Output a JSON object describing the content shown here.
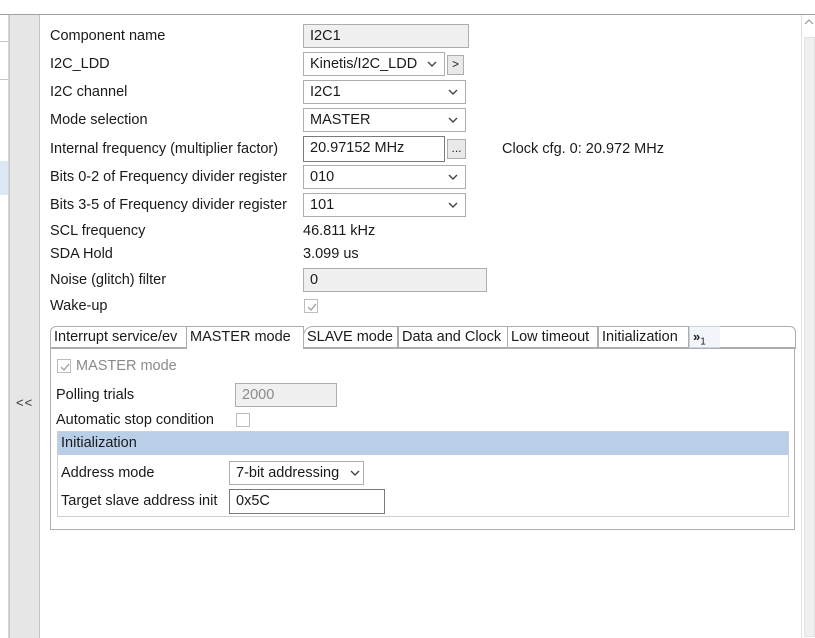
{
  "collapse": {
    "label": "<<"
  },
  "props": {
    "component_name": {
      "label": "Component name",
      "value": "I2C1"
    },
    "i2c_ldd": {
      "label": "I2C_LDD",
      "value": "Kinetis/I2C_LDD",
      "goto": ">"
    },
    "channel": {
      "label": "I2C channel",
      "value": "I2C1"
    },
    "mode": {
      "label": "Mode selection",
      "value": "MASTER"
    },
    "int_freq": {
      "label": "Internal frequency (multiplier factor)",
      "value": "20.97152 MHz",
      "browse": "...",
      "clock_note": "Clock cfg. 0: 20.972 MHz"
    },
    "bits02": {
      "label": "Bits 0-2 of Frequency divider register",
      "value": "010"
    },
    "bits35": {
      "label": "Bits 3-5 of Frequency divider register",
      "value": "101"
    },
    "scl": {
      "label": "SCL frequency",
      "value": "46.811 kHz"
    },
    "sda_hold": {
      "label": "SDA Hold",
      "value": "3.099 us"
    },
    "noise": {
      "label": "Noise (glitch) filter",
      "value": "0"
    },
    "wakeup": {
      "label": "Wake-up",
      "checked": true
    }
  },
  "tabs": [
    {
      "label": "Interrupt service/ev"
    },
    {
      "label": "MASTER mode",
      "active": true
    },
    {
      "label": "SLAVE mode"
    },
    {
      "label": "Data and Clock"
    },
    {
      "label": "Low timeout"
    },
    {
      "label": "Initialization"
    },
    {
      "label": "»",
      "sub": "1"
    }
  ],
  "master": {
    "mode_label": "MASTER mode",
    "mode_checked": true,
    "polling_label": "Polling trials",
    "polling_value": "2000",
    "auto_stop_label": "Automatic stop condition",
    "auto_stop_checked": false
  },
  "init_section": {
    "title": "Initialization",
    "address_mode_label": "Address mode",
    "address_mode_value": "7-bit addressing",
    "target_label": "Target slave address init",
    "target_value": "0x5C"
  },
  "colors": {
    "section_header": "#b9cfe8",
    "selection": "#dce8f5"
  }
}
